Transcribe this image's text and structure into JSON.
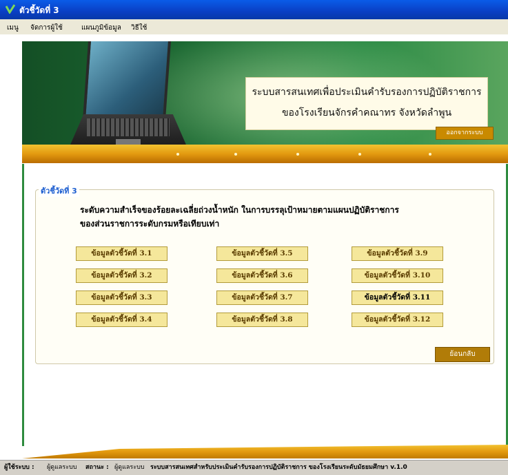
{
  "window": {
    "title": "ตัวชี้วัดที่ 3"
  },
  "menu": [
    "เมนู",
    "จัดการผู้ใช้",
    "แผนภูมิข้อมูล",
    "วิธีใช้"
  ],
  "banner": {
    "title_line1": "ระบบสารสนเทศเพื่อประเมินคำรับรองการปฏิบัติราชการ",
    "title_line2": "ของโรงเรียนจักรคำคณาทร จังหวัดลำพูน",
    "logout_label": "ออกจากระบบ"
  },
  "indicator": {
    "legend": "ตัวชี้วัดที่ 3",
    "description_line1": "ระดับความสำเร็จของร้อยละเฉลี่ยถ่วงน้ำหนัก ในการบรรลุเป้าหมายตามแผนปฏิบัติราชการ",
    "description_line2": "ของส่วนราชการระดับกรมหรือเทียบเท่า",
    "buttons": [
      "ข้อมูลตัวชี้วัดที่ 3.1",
      "ข้อมูลตัวชี้วัดที่ 3.2",
      "ข้อมูลตัวชี้วัดที่ 3.3",
      "ข้อมูลตัวชี้วัดที่ 3.4",
      "ข้อมูลตัวชี้วัดที่ 3.5",
      "ข้อมูลตัวชี้วัดที่ 3.6",
      "ข้อมูลตัวชี้วัดที่ 3.7",
      "ข้อมูลตัวชี้วัดที่ 3.8",
      "ข้อมูลตัวชี้วัดที่ 3.9",
      "ข้อมูลตัวชี้วัดที่ 3.10",
      "ข้อมูลตัวชี้วัดที่ 3.11",
      "ข้อมูลตัวชี้วัดที่ 3.12"
    ],
    "back_label": "ย้อนกลับ"
  },
  "statusbar": {
    "user_label": "ผู้ใช้ระบบ :",
    "user_value": "ผู้ดูแลระบบ",
    "status_label": "สถานะ :",
    "status_value": "ผู้ดูแลระบบ",
    "system_name": "ระบบสารสนเทศสำหรับประเมินคำรับรองการปฏิบัติราชการ ของโรงเรียนระดับมัธยมศึกษา v.1.0"
  },
  "colors": {
    "accent": "#1e5fd0",
    "button_fill": "#f5e79b",
    "brand_green": "#1e7a3e",
    "gold": "#e39a10"
  }
}
